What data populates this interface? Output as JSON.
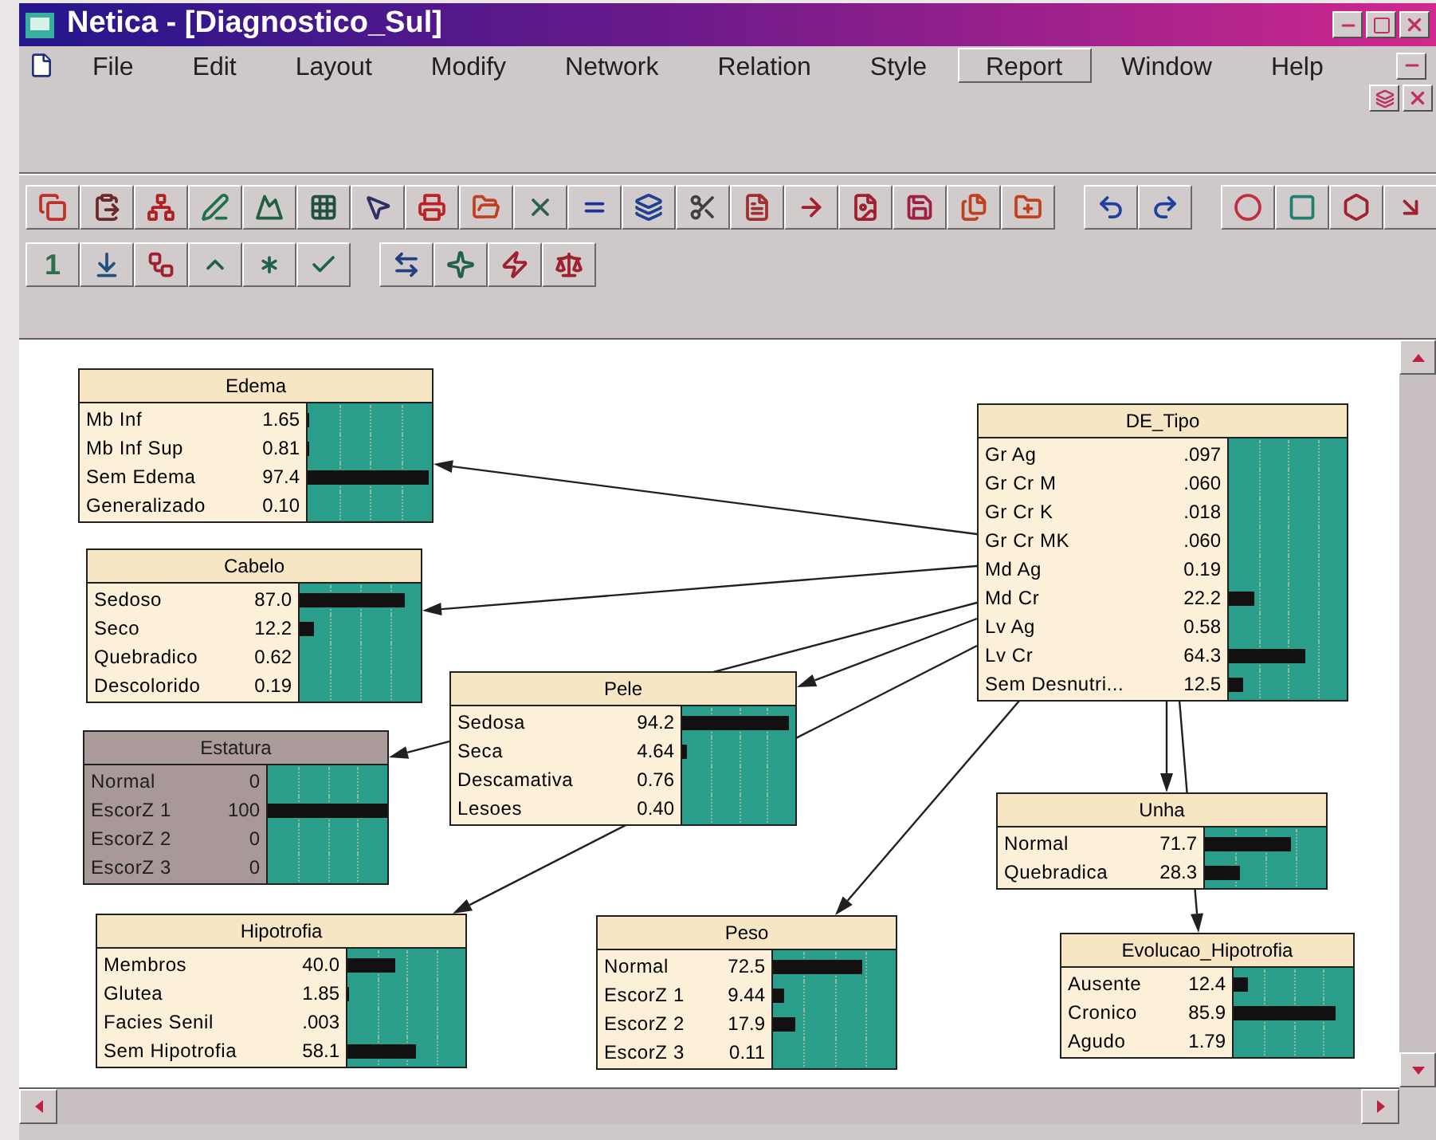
{
  "window": {
    "title": "Netica - [Diagnostico_Sul]"
  },
  "menu": [
    {
      "label": "File",
      "selected": false
    },
    {
      "label": "Edit",
      "selected": false
    },
    {
      "label": "Layout",
      "selected": false
    },
    {
      "label": "Modify",
      "selected": false
    },
    {
      "label": "Network",
      "selected": false
    },
    {
      "label": "Relation",
      "selected": false
    },
    {
      "label": "Style",
      "selected": false
    },
    {
      "label": "Report",
      "selected": true
    },
    {
      "label": "Window",
      "selected": false
    },
    {
      "label": "Help",
      "selected": false
    }
  ],
  "toolbar_2": {
    "label": "1"
  },
  "nodes": [
    {
      "title": "Edema",
      "kind": "normal",
      "states": [
        {
          "label": "Mb Inf",
          "value": "1.65",
          "level": 0.0165
        },
        {
          "label": "Mb Inf Sup",
          "value": "0.81",
          "level": 0.0081
        },
        {
          "label": "Sem Edema",
          "value": "97.4",
          "level": 0.974
        },
        {
          "label": "Generalizado",
          "value": "0.10"
        }
      ]
    },
    {
      "title": "Cabelo",
      "kind": "normal",
      "states": [
        {
          "label": "Sedoso",
          "value": "87.0",
          "level": 0.87
        },
        {
          "label": "Seco",
          "value": "12.2",
          "level": 0.122
        },
        {
          "label": "Quebradico",
          "value": "0.62"
        },
        {
          "label": "Descolorido",
          "value": "0.19"
        }
      ]
    },
    {
      "title": "Estatura",
      "kind": "finding",
      "states": [
        {
          "label": "Normal",
          "value": "0"
        },
        {
          "label": "EscorZ 1",
          "value": "100",
          "level": 1
        },
        {
          "label": "EscorZ 2",
          "value": "0"
        },
        {
          "label": "EscorZ 3",
          "value": "0"
        }
      ]
    },
    {
      "title": "Pele",
      "kind": "normal",
      "states": [
        {
          "label": "Sedosa",
          "value": "94.2",
          "level": 0.942
        },
        {
          "label": "Seca",
          "value": "4.64",
          "level": 0.0464
        },
        {
          "label": "Descamativa",
          "value": "0.76"
        },
        {
          "label": "Lesoes",
          "value": "0.40"
        }
      ]
    },
    {
      "title": "DE_Tipo",
      "kind": "normal",
      "states": [
        {
          "label": "Gr Ag",
          "value": ".097"
        },
        {
          "label": "Gr Cr M",
          "value": ".060"
        },
        {
          "label": "Gr Cr K",
          "value": ".018"
        },
        {
          "label": "Gr Cr MK",
          "value": ".060"
        },
        {
          "label": "Md Ag",
          "value": "0.19"
        },
        {
          "label": "Md Cr",
          "value": "22.2",
          "level": 0.222
        },
        {
          "label": "Lv Ag",
          "value": "0.58"
        },
        {
          "label": "Lv Cr",
          "value": "64.3",
          "level": 0.643
        },
        {
          "label": "Sem Desnutri...",
          "value": "12.5",
          "level": 0.125
        }
      ]
    },
    {
      "title": "Unha",
      "kind": "normal",
      "states": [
        {
          "label": "Normal",
          "value": "71.7",
          "level": 0.717
        },
        {
          "label": "Quebradica",
          "value": "28.3",
          "level": 0.283
        }
      ]
    },
    {
      "title": "Hipotrofia",
      "kind": "normal",
      "states": [
        {
          "label": "Membros",
          "value": "40.0",
          "level": 0.4
        },
        {
          "label": "Glutea",
          "value": "1.85",
          "level": 0.0185
        },
        {
          "label": "Facies Senil",
          "value": ".003"
        },
        {
          "label": "Sem Hipotrofia",
          "value": "58.1",
          "level": 0.581
        }
      ]
    },
    {
      "title": "Peso",
      "kind": "normal",
      "states": [
        {
          "label": "Normal",
          "value": "72.5",
          "level": 0.725
        },
        {
          "label": "EscorZ 1",
          "value": "9.44",
          "level": 0.0944
        },
        {
          "label": "EscorZ 2",
          "value": "17.9",
          "level": 0.179
        },
        {
          "label": "EscorZ 3",
          "value": "0.11"
        }
      ]
    },
    {
      "title": "Evolucao_Hipotrofia",
      "kind": "normal",
      "states": [
        {
          "label": "Ausente",
          "value": "12.4",
          "level": 0.124
        },
        {
          "label": "Cronico",
          "value": "85.9",
          "level": 0.859
        },
        {
          "label": "Agudo",
          "value": "1.79"
        }
      ]
    }
  ]
}
